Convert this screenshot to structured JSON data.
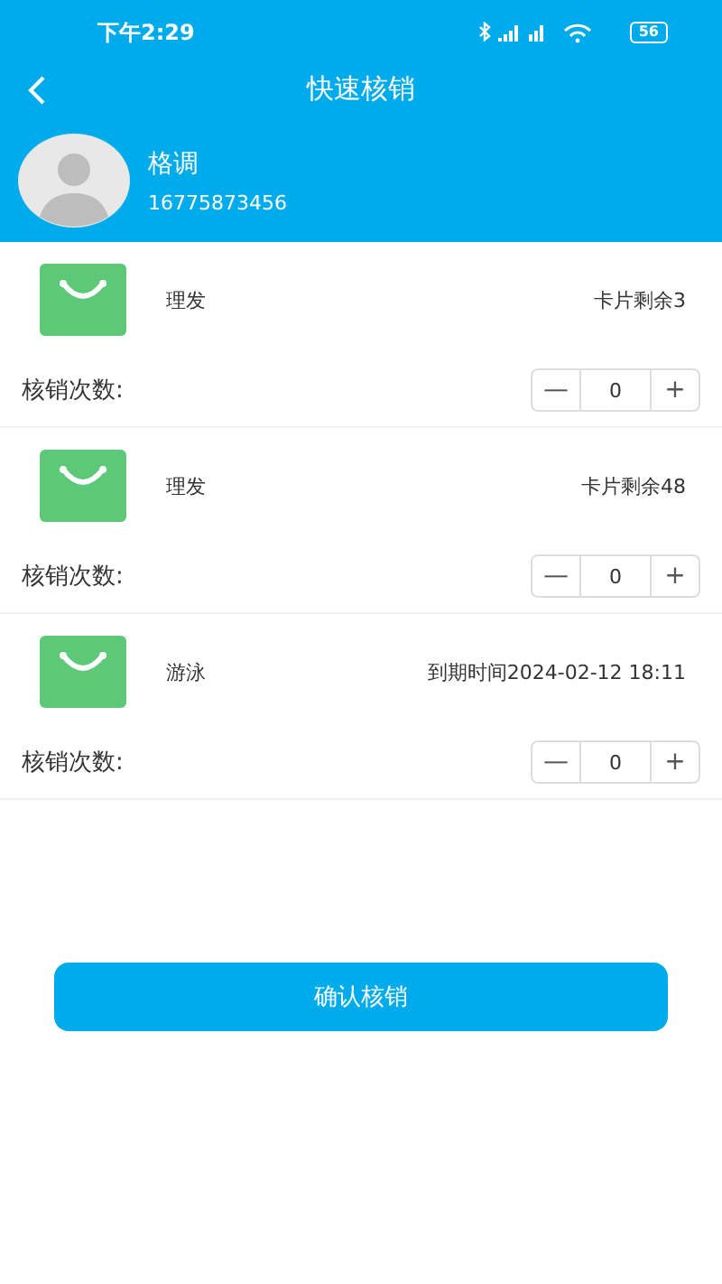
{
  "status_bar": {
    "time": "下午2:29",
    "battery": "56"
  },
  "nav": {
    "title": "快速核销"
  },
  "user": {
    "name": "格调",
    "phone": "16775873456"
  },
  "cards": [
    {
      "name": "理发",
      "info": "卡片剩余3",
      "count_label": "核销次数:",
      "count": "0",
      "minus": "—",
      "plus": "+"
    },
    {
      "name": "理发",
      "info": "卡片剩余48",
      "count_label": "核销次数:",
      "count": "0",
      "minus": "—",
      "plus": "+"
    },
    {
      "name": "游泳",
      "info": "到期时间2024-02-12 18:11",
      "count_label": "核销次数:",
      "count": "0",
      "minus": "—",
      "plus": "+"
    }
  ],
  "confirm_button": "确认核销"
}
